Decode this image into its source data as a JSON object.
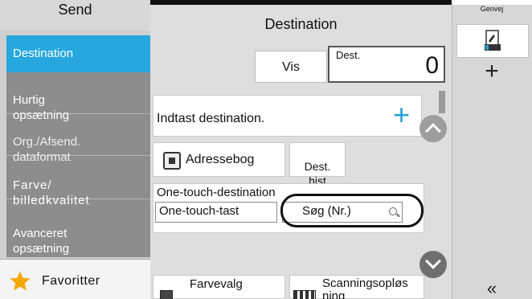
{
  "sidebar": {
    "title": "Send",
    "items": [
      {
        "label": "Destination",
        "active": true
      },
      {
        "label": "Hurtig\nopsætning"
      },
      {
        "label": "Org./Afsend.\ndataformat"
      },
      {
        "label": "Farve/\nbilledkvalitet"
      },
      {
        "label": "Avanceret\nopsætning"
      }
    ],
    "favorites_label": "Favoritter"
  },
  "main": {
    "title": "Destination",
    "view_button": "Vis",
    "dest_label": "Dest.",
    "dest_count": "0",
    "enter_destination": "Indtast destination.",
    "address_book": "Adressebog",
    "dest_history": "Dest.\nhist",
    "one_touch_title": "One-touch-destination",
    "one_touch_key": "One-touch-tast",
    "search_number": "Søg (Nr.)",
    "color_selection": "Farvevalg",
    "scan_resolution": "Scanningsopløs\nning"
  },
  "right_panel": {
    "title": "Genvej",
    "add_symbol": "+",
    "collapse_symbol": "«"
  },
  "colors": {
    "accent": "#26a7dd",
    "sidebar_bg": "#8d8d8d",
    "plus_blue": "#2b9fd9",
    "star": "#f5a800"
  }
}
